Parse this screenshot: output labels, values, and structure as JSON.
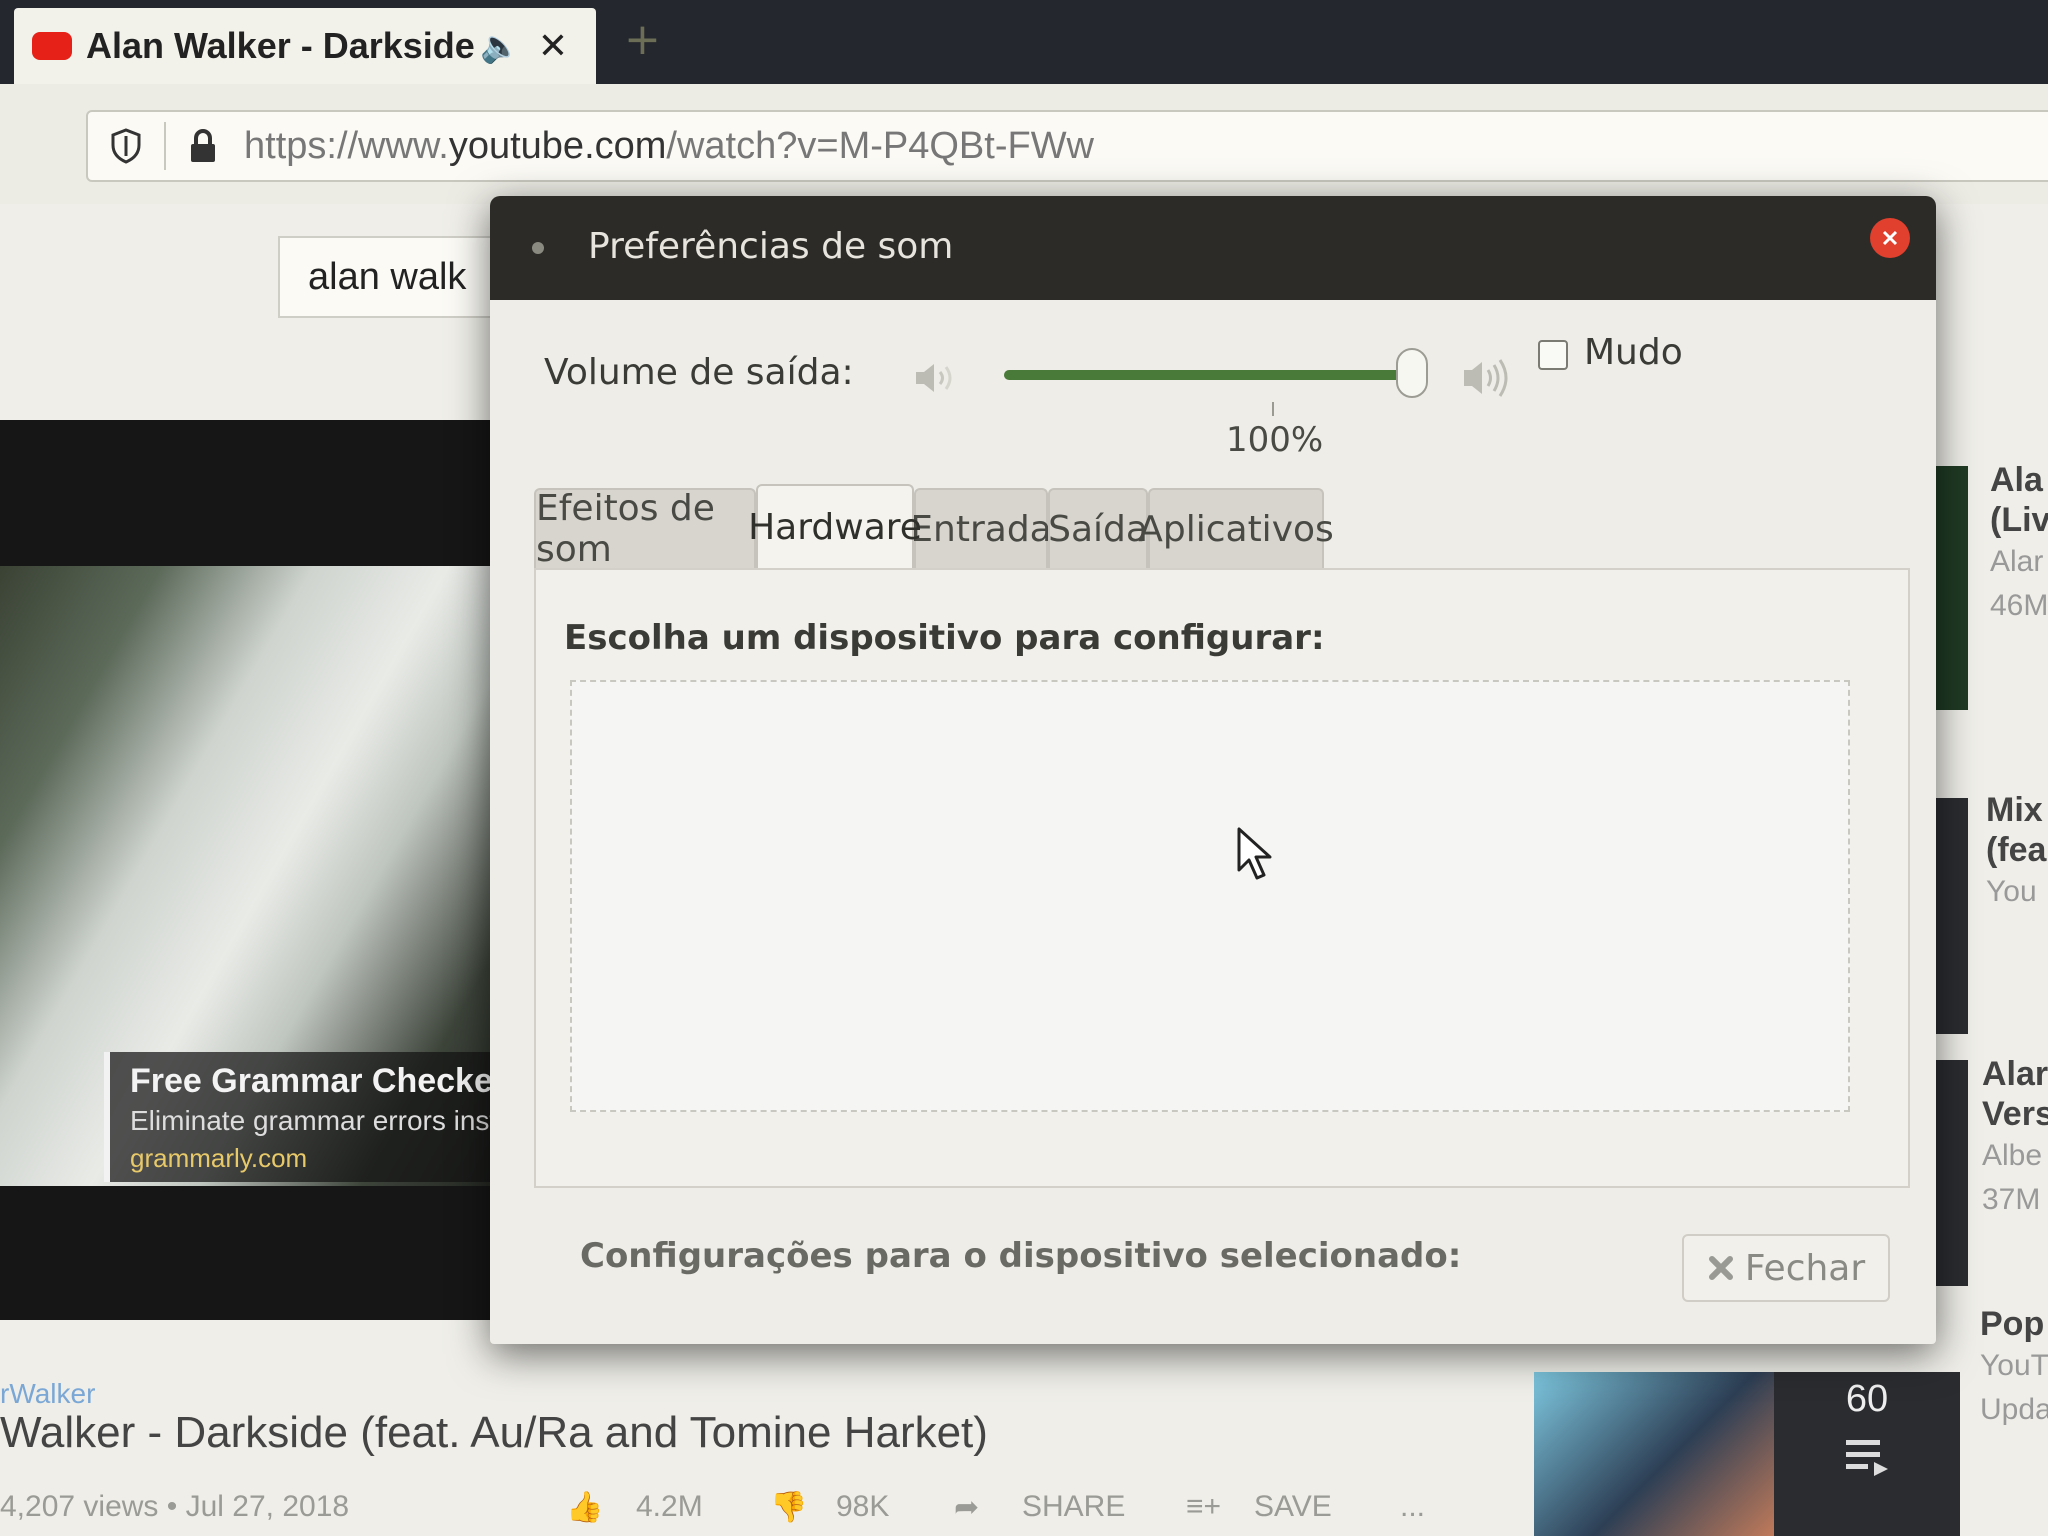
{
  "browser": {
    "tab_title": "Alan Walker - Darkside",
    "url_prefix": "https://www.",
    "url_domain": "youtube.com",
    "url_path": "/watch?v=M-P4QBt-FWw"
  },
  "page": {
    "search_query": "alan walk",
    "ad": {
      "title": "Free Grammar Checker",
      "subtitle": "Eliminate grammar errors inst",
      "url": "grammarly.com"
    },
    "channel": "rWalker",
    "video_title": "Walker - Darkside (feat. Au/Ra and Tomine Harket)",
    "views": "4,207 views • Jul 27, 2018",
    "likes": "4.2M",
    "dislikes": "98K",
    "share_label": "SHARE",
    "save_label": "SAVE",
    "more_label": "...",
    "sidebar": [
      {
        "title1": "Ala",
        "title2": "(Liv",
        "sub1": "Alar",
        "sub2": "46M"
      },
      {
        "title1": "Mix",
        "title2": "(fea",
        "sub1": "You"
      },
      {
        "title1": "Alar",
        "title2": "Vers",
        "sub1": "Albe",
        "sub2": "37M"
      },
      {
        "title1": "Pop",
        "sub1": "YouT",
        "sub2": "Upda"
      }
    ],
    "thumb_count": "60"
  },
  "dialog": {
    "title": "Preferências de som",
    "volume_label": "Volume de saída:",
    "volume_level": 100,
    "volume_text": "100%",
    "mute_label": "Mudo",
    "tabs": [
      "Efeitos de som",
      "Hardware",
      "Entrada",
      "Saída",
      "Aplicativos"
    ],
    "active_tab": "Hardware",
    "choose_label": "Escolha um dispositivo para configurar:",
    "settings_label": "Configurações para o dispositivo selecionado:",
    "close_label": "Fechar"
  }
}
